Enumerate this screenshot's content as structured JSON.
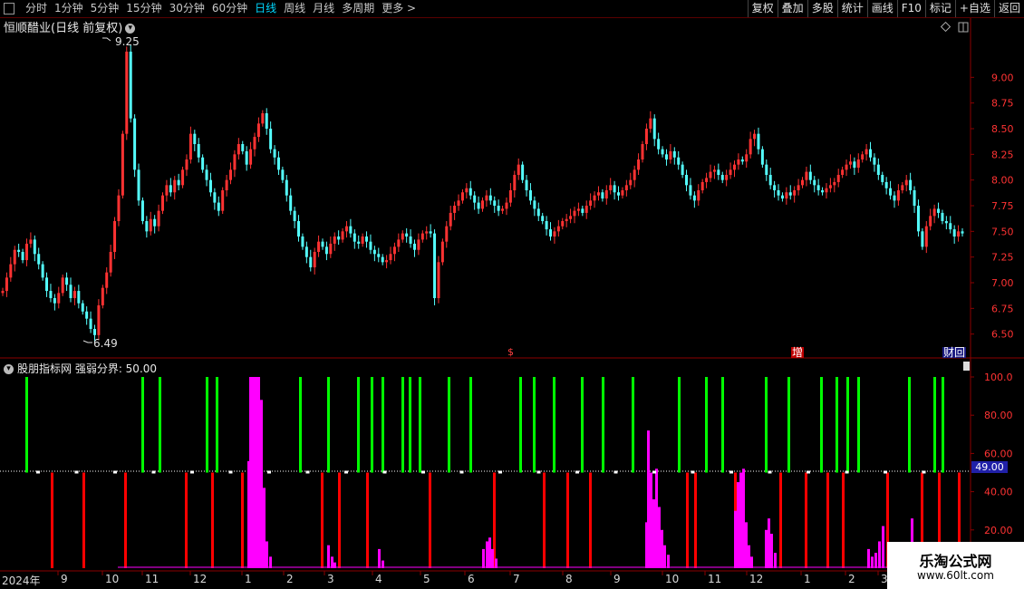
{
  "toolbar": {
    "periods": [
      "分时",
      "1分钟",
      "5分钟",
      "15分钟",
      "30分钟",
      "60分钟",
      "日线",
      "周线",
      "月线",
      "多周期",
      "更多 >"
    ],
    "active_period": "日线",
    "actions": [
      "复权",
      "叠加",
      "多股",
      "统计",
      "画线",
      "F10",
      "标记",
      "+自选",
      "返回"
    ]
  },
  "stock": {
    "title": "恒顺醋业(日线 前复权)",
    "high_label": "9.25",
    "low_label": "6.49"
  },
  "indicator": {
    "title": "股朋指标网 强弱分界: 50.00",
    "current_value": "49.00"
  },
  "tags": {
    "tag1": "$",
    "tag2": "增",
    "tag3": "财回"
  },
  "watermark": {
    "line1": "乐淘公式网",
    "line2": "www.60lt.com"
  },
  "colors": {
    "up": "#ff3232",
    "down": "#54ffff",
    "bull_bar": "#00ff00",
    "bear_bar": "#ff0000",
    "volume": "#ff00ff",
    "axis": "#8b0000",
    "label": "#ff3333"
  },
  "chart_data": {
    "type": "candlestick",
    "ylim": [
      6.4,
      9.4
    ],
    "yticks": [
      "9.00",
      "8.75",
      "8.50",
      "8.25",
      "8.00",
      "7.75",
      "7.50",
      "7.25",
      "7.00",
      "6.75",
      "6.50"
    ],
    "closes": [
      6.92,
      7.05,
      7.18,
      7.32,
      7.3,
      7.22,
      7.38,
      7.42,
      7.28,
      7.18,
      7.05,
      6.92,
      6.85,
      6.8,
      6.9,
      7.05,
      6.98,
      6.85,
      6.92,
      6.8,
      6.72,
      6.65,
      6.55,
      6.49,
      6.78,
      6.95,
      7.1,
      7.3,
      7.6,
      7.85,
      8.45,
      9.25,
      8.6,
      8.1,
      7.8,
      7.6,
      7.5,
      7.62,
      7.55,
      7.7,
      7.85,
      7.95,
      7.88,
      8.0,
      7.95,
      8.1,
      8.2,
      8.45,
      8.35,
      8.22,
      8.1,
      8.0,
      7.88,
      7.78,
      7.7,
      7.9,
      8.0,
      8.1,
      8.25,
      8.35,
      8.28,
      8.15,
      8.3,
      8.42,
      8.55,
      8.65,
      8.5,
      8.3,
      8.22,
      8.1,
      8.0,
      7.85,
      7.7,
      7.6,
      7.45,
      7.35,
      7.25,
      7.15,
      7.3,
      7.4,
      7.35,
      7.28,
      7.38,
      7.45,
      7.42,
      7.5,
      7.55,
      7.48,
      7.4,
      7.38,
      7.45,
      7.4,
      7.32,
      7.28,
      7.25,
      7.2,
      7.22,
      7.28,
      7.35,
      7.42,
      7.48,
      7.45,
      7.38,
      7.32,
      7.42,
      7.48,
      7.5,
      7.48,
      6.85,
      7.2,
      7.4,
      7.55,
      7.68,
      7.75,
      7.8,
      7.88,
      7.92,
      7.85,
      7.78,
      7.72,
      7.8,
      7.85,
      7.8,
      7.75,
      7.7,
      7.72,
      7.78,
      7.9,
      8.05,
      8.15,
      8.0,
      7.9,
      7.8,
      7.72,
      7.65,
      7.6,
      7.52,
      7.45,
      7.5,
      7.55,
      7.6,
      7.62,
      7.65,
      7.7,
      7.72,
      7.68,
      7.75,
      7.8,
      7.85,
      7.88,
      7.82,
      7.9,
      7.95,
      7.88,
      7.85,
      7.9,
      7.95,
      8.0,
      8.1,
      8.2,
      8.35,
      8.5,
      8.6,
      8.4,
      8.3,
      8.25,
      8.2,
      8.28,
      8.22,
      8.15,
      8.05,
      7.95,
      7.85,
      7.8,
      7.9,
      7.98,
      8.02,
      8.08,
      8.1,
      8.05,
      8.0,
      8.05,
      8.1,
      8.15,
      8.2,
      8.18,
      8.25,
      8.4,
      8.45,
      8.3,
      8.15,
      8.05,
      7.95,
      7.9,
      7.85,
      7.82,
      7.88,
      7.85,
      7.9,
      7.95,
      8.0,
      8.08,
      8.0,
      7.95,
      7.9,
      7.88,
      7.92,
      7.95,
      7.98,
      8.05,
      8.1,
      8.15,
      8.18,
      8.12,
      8.2,
      8.25,
      8.3,
      8.22,
      8.15,
      8.05,
      7.98,
      7.92,
      7.85,
      7.8,
      7.9,
      7.95,
      8.0,
      7.9,
      7.75,
      7.5,
      7.35,
      7.55,
      7.65,
      7.72,
      7.68,
      7.6,
      7.58,
      7.52,
      7.45,
      7.5,
      7.48
    ],
    "indicator_ylim": [
      0,
      110
    ],
    "indicator_yticks": [
      "100.0",
      "80.00",
      "60.00",
      "40.00",
      "20.00"
    ],
    "threshold": 50.0,
    "signal_bars": [
      {
        "x": 29,
        "v": 100
      },
      {
        "x": 57,
        "v": 0
      },
      {
        "x": 92,
        "v": 0
      },
      {
        "x": 138,
        "v": 0
      },
      {
        "x": 157,
        "v": 100
      },
      {
        "x": 176,
        "v": 100
      },
      {
        "x": 205,
        "v": 0
      },
      {
        "x": 228,
        "v": 100
      },
      {
        "x": 234,
        "v": 0
      },
      {
        "x": 239,
        "v": 100
      },
      {
        "x": 267,
        "v": 0
      },
      {
        "x": 331,
        "v": 100
      },
      {
        "x": 355,
        "v": 0
      },
      {
        "x": 362,
        "v": 100
      },
      {
        "x": 374,
        "v": 0
      },
      {
        "x": 395,
        "v": 100
      },
      {
        "x": 405,
        "v": 0
      },
      {
        "x": 410,
        "v": 100
      },
      {
        "x": 422,
        "v": 100
      },
      {
        "x": 444,
        "v": 100
      },
      {
        "x": 452,
        "v": 100
      },
      {
        "x": 463,
        "v": 100
      },
      {
        "x": 474,
        "v": 0
      },
      {
        "x": 495,
        "v": 100
      },
      {
        "x": 519,
        "v": 100
      },
      {
        "x": 545,
        "v": 0
      },
      {
        "x": 574,
        "v": 100
      },
      {
        "x": 589,
        "v": 100
      },
      {
        "x": 600,
        "v": 0
      },
      {
        "x": 611,
        "v": 100
      },
      {
        "x": 626,
        "v": 0
      },
      {
        "x": 642,
        "v": 100
      },
      {
        "x": 651,
        "v": 0
      },
      {
        "x": 665,
        "v": 100
      },
      {
        "x": 698,
        "v": 100
      },
      {
        "x": 716,
        "v": 0
      },
      {
        "x": 749,
        "v": 100
      },
      {
        "x": 758,
        "v": 0
      },
      {
        "x": 767,
        "v": 0
      },
      {
        "x": 779,
        "v": 100
      },
      {
        "x": 797,
        "v": 100
      },
      {
        "x": 811,
        "v": 0
      },
      {
        "x": 845,
        "v": 100
      },
      {
        "x": 861,
        "v": 0
      },
      {
        "x": 870,
        "v": 100
      },
      {
        "x": 889,
        "v": 0
      },
      {
        "x": 906,
        "v": 100
      },
      {
        "x": 913,
        "v": 0
      },
      {
        "x": 923,
        "v": 100
      },
      {
        "x": 930,
        "v": 0
      },
      {
        "x": 935,
        "v": 100
      },
      {
        "x": 947,
        "v": 100
      },
      {
        "x": 979,
        "v": 0
      },
      {
        "x": 1003,
        "v": 100
      },
      {
        "x": 1017,
        "v": 0
      },
      {
        "x": 1031,
        "v": 100
      },
      {
        "x": 1036,
        "v": 0
      },
      {
        "x": 1040,
        "v": 100
      },
      {
        "x": 1058,
        "v": 0
      }
    ],
    "volume_spikes": [
      {
        "x": 274,
        "v": 56
      },
      {
        "x": 276,
        "v": 100
      },
      {
        "x": 279,
        "v": 100
      },
      {
        "x": 282,
        "v": 100
      },
      {
        "x": 285,
        "v": 100
      },
      {
        "x": 288,
        "v": 88
      },
      {
        "x": 291,
        "v": 42
      },
      {
        "x": 294,
        "v": 14
      },
      {
        "x": 298,
        "v": 6
      },
      {
        "x": 362,
        "v": 12
      },
      {
        "x": 366,
        "v": 6
      },
      {
        "x": 369,
        "v": 3
      },
      {
        "x": 418,
        "v": 10
      },
      {
        "x": 422,
        "v": 4
      },
      {
        "x": 533,
        "v": 10
      },
      {
        "x": 537,
        "v": 14
      },
      {
        "x": 540,
        "v": 16
      },
      {
        "x": 543,
        "v": 10
      },
      {
        "x": 547,
        "v": 5
      },
      {
        "x": 713,
        "v": 24
      },
      {
        "x": 715,
        "v": 72
      },
      {
        "x": 718,
        "v": 50
      },
      {
        "x": 721,
        "v": 36
      },
      {
        "x": 724,
        "v": 52
      },
      {
        "x": 727,
        "v": 32
      },
      {
        "x": 730,
        "v": 20
      },
      {
        "x": 733,
        "v": 12
      },
      {
        "x": 737,
        "v": 7
      },
      {
        "x": 811,
        "v": 30
      },
      {
        "x": 814,
        "v": 45
      },
      {
        "x": 817,
        "v": 50
      },
      {
        "x": 820,
        "v": 52
      },
      {
        "x": 823,
        "v": 24
      },
      {
        "x": 826,
        "v": 12
      },
      {
        "x": 829,
        "v": 6
      },
      {
        "x": 845,
        "v": 20
      },
      {
        "x": 848,
        "v": 26
      },
      {
        "x": 851,
        "v": 18
      },
      {
        "x": 855,
        "v": 8
      },
      {
        "x": 958,
        "v": 10
      },
      {
        "x": 962,
        "v": 6
      },
      {
        "x": 966,
        "v": 8
      },
      {
        "x": 970,
        "v": 14
      },
      {
        "x": 974,
        "v": 22
      },
      {
        "x": 1006,
        "v": 26
      },
      {
        "x": 1009,
        "v": 8
      }
    ],
    "x_axis": {
      "start": "2024年",
      "ticks": [
        {
          "label": "9",
          "x": 64
        },
        {
          "label": "10",
          "x": 113
        },
        {
          "label": "11",
          "x": 157
        },
        {
          "label": "12",
          "x": 210
        },
        {
          "label": "1",
          "x": 267
        },
        {
          "label": "2",
          "x": 313
        },
        {
          "label": "3",
          "x": 358
        },
        {
          "label": "4",
          "x": 411
        },
        {
          "label": "5",
          "x": 464
        },
        {
          "label": "6",
          "x": 513
        },
        {
          "label": "7",
          "x": 563
        },
        {
          "label": "8",
          "x": 621
        },
        {
          "label": "9",
          "x": 674
        },
        {
          "label": "10",
          "x": 731
        },
        {
          "label": "11",
          "x": 778
        },
        {
          "label": "12",
          "x": 824
        },
        {
          "label": "1",
          "x": 884
        },
        {
          "label": "2",
          "x": 933
        },
        {
          "label": "3",
          "x": 969
        }
      ]
    }
  }
}
